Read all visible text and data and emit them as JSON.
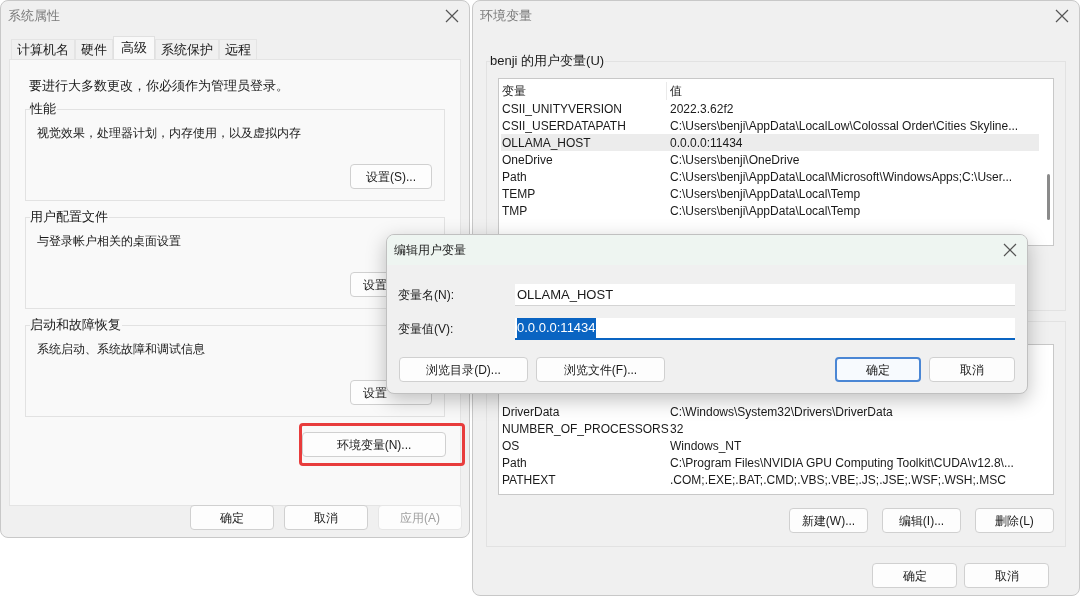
{
  "system_properties": {
    "title": "系统属性",
    "tabs": [
      {
        "label": "计算机名",
        "selected": false
      },
      {
        "label": "硬件",
        "selected": false
      },
      {
        "label": "高级",
        "selected": true
      },
      {
        "label": "系统保护",
        "selected": false
      },
      {
        "label": "远程",
        "selected": false
      }
    ],
    "notice": "要进行大多数更改，你必须作为管理员登录。",
    "groups": [
      {
        "title": "性能",
        "description": "视觉效果，处理器计划，内存使用，以及虚拟内存",
        "button": "设置(S)..."
      },
      {
        "title": "用户配置文件",
        "description": "与登录帐户相关的桌面设置",
        "button": "设置"
      },
      {
        "title": "启动和故障恢复",
        "description": "系统启动、系统故障和调试信息",
        "button": "设置"
      }
    ],
    "env_button": {
      "label": "环境变量(N)...",
      "highlighted": true
    },
    "buttons": [
      {
        "label": "确定",
        "disabled": false
      },
      {
        "label": "取消",
        "disabled": false
      },
      {
        "label": "应用(A)",
        "disabled": true
      }
    ]
  },
  "environment_variables": {
    "title": "环境变量",
    "user_group": {
      "title": "benji 的用户变量(U)",
      "columns": [
        "变量",
        "值"
      ],
      "rows": [
        {
          "name": "CSII_UNITYVERSION",
          "value": "2022.3.62f2",
          "selected": false
        },
        {
          "name": "CSII_USERDATAPATH",
          "value": "C:\\Users\\benji\\AppData\\LocalLow\\Colossal Order\\Cities Skyline...",
          "selected": false
        },
        {
          "name": "OLLAMA_HOST",
          "value": "0.0.0.0:11434",
          "selected": true
        },
        {
          "name": "OneDrive",
          "value": "C:\\Users\\benji\\OneDrive",
          "selected": false
        },
        {
          "name": "Path",
          "value": "C:\\Users\\benji\\AppData\\Local\\Microsoft\\WindowsApps;C:\\User...",
          "selected": false
        },
        {
          "name": "TEMP",
          "value": "C:\\Users\\benji\\AppData\\Local\\Temp",
          "selected": false
        },
        {
          "name": "TMP",
          "value": "C:\\Users\\benji\\AppData\\Local\\Temp",
          "selected": false
        }
      ]
    },
    "system_group": {
      "rows": [
        {
          "name": "DriverData",
          "value": "C:\\Windows\\System32\\Drivers\\DriverData"
        },
        {
          "name": "NUMBER_OF_PROCESSORS",
          "value": "32"
        },
        {
          "name": "OS",
          "value": "Windows_NT"
        },
        {
          "name": "Path",
          "value": "C:\\Program Files\\NVIDIA GPU Computing Toolkit\\CUDA\\v12.8\\..."
        },
        {
          "name": "PATHEXT",
          "value": ".COM;.EXE;.BAT;.CMD;.VBS;.VBE;.JS;.JSE;.WSF;.WSH;.MSC"
        }
      ],
      "buttons": [
        "新建(W)...",
        "编辑(I)...",
        "删除(L)"
      ]
    },
    "buttons": [
      "确定",
      "取消"
    ]
  },
  "edit_dialog": {
    "title": "编辑用户变量",
    "fields": [
      {
        "label": "变量名(N):",
        "value": "OLLAMA_HOST",
        "text_selected": false
      },
      {
        "label": "变量值(V):",
        "value": "0.0.0.0:11434",
        "text_selected": true
      }
    ],
    "buttons": [
      {
        "label": "浏览目录(D)...",
        "default": false
      },
      {
        "label": "浏览文件(F)...",
        "default": false
      },
      {
        "label": "确定",
        "default": true
      },
      {
        "label": "取消",
        "default": false
      }
    ]
  }
}
